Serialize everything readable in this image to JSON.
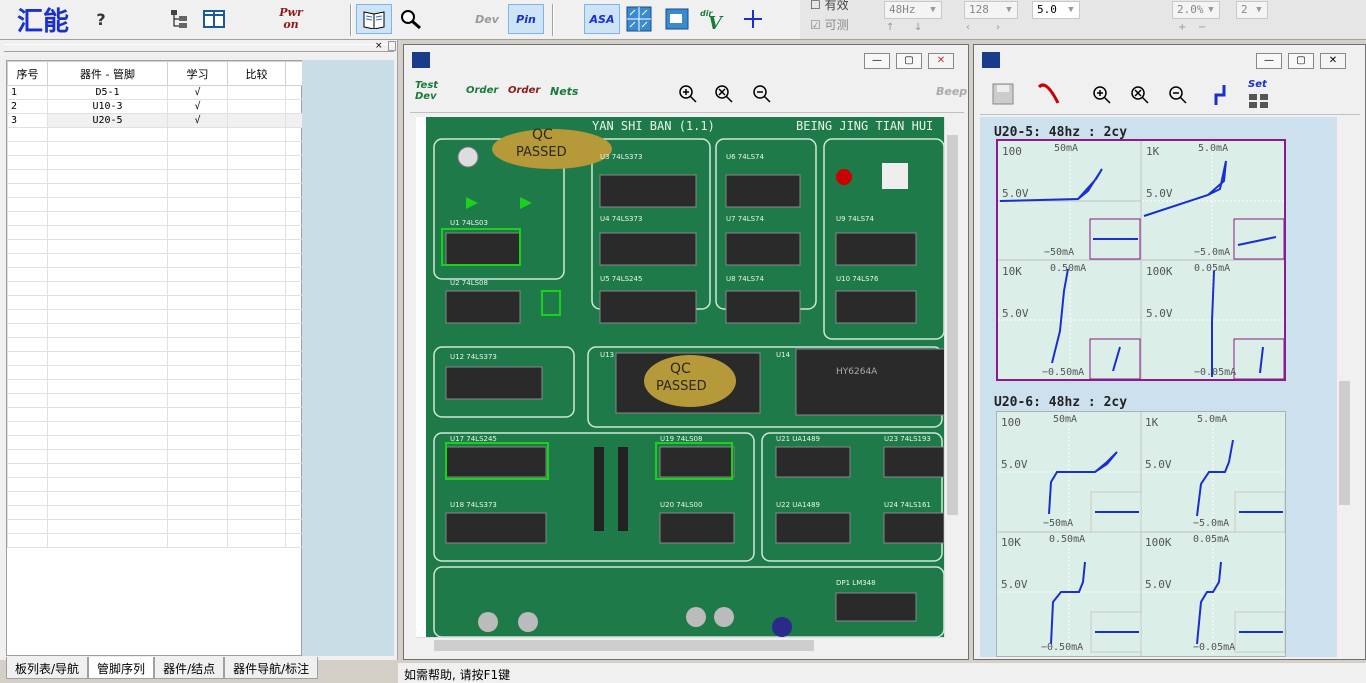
{
  "toolbar": {
    "logo": "汇能",
    "help": "?",
    "pwr_top": "Pwr",
    "pwr_bottom": "on",
    "dev": "Dev",
    "pin": "Pin",
    "asa": "ASA",
    "dirv": "V",
    "dir_small": "dir"
  },
  "params": {
    "row1_label": "有效",
    "row2_label": "可测",
    "freq": "48Hz",
    "points": "128",
    "volt": "5.0",
    "pct": "2.0%",
    "count": "2"
  },
  "left": {
    "columns": [
      "序号",
      "器件 - 管脚",
      "学习",
      "比较"
    ],
    "rows": [
      {
        "n": "1",
        "dev": "D5-1",
        "learn": "√"
      },
      {
        "n": "2",
        "dev": "U10-3",
        "learn": "√"
      },
      {
        "n": "3",
        "dev": "U20-5",
        "learn": "√"
      }
    ],
    "tabs": [
      "板列表/导航",
      "管脚序列",
      "器件/结点",
      "器件导航/标注"
    ]
  },
  "board_win": {
    "tools": [
      "Test Dev",
      "Order",
      "Order",
      "Nets"
    ],
    "beep": "Beep",
    "board_title": "YAN SHI BAN (1.1)",
    "board_title2": "BEING JING TIAN HUI",
    "chips": [
      "U3  74LS373",
      "U6  74LS74",
      "U4  74LS373",
      "U7  74LS74",
      "U9  74LS74",
      "U5  74LS245",
      "U8  74LS74",
      "U10 74LS76",
      "U1  74LS03",
      "U2  74LS08",
      "U12  74LS373",
      "U13",
      "U14",
      "U17  74LS245",
      "U19  74LS08",
      "U21  UA1489",
      "U23  74LS193",
      "U18  74LS373",
      "U20  74LS00",
      "U22  UA1489",
      "U24  74LS161",
      "DP1  LM348"
    ],
    "qc1": "QC",
    "qc2": "PASSED",
    "ram": "HY6264A"
  },
  "wave_win": {
    "set": "Set",
    "groups": [
      {
        "title": "U20-5:  48hz  :  2cy",
        "cells": [
          {
            "r": "100",
            "i": "50mA",
            "v": "5.0V",
            "ni": "−50mA"
          },
          {
            "r": "1K",
            "i": "5.0mA",
            "v": "5.0V",
            "ni": "−5.0mA"
          },
          {
            "r": "10K",
            "i": "0.50mA",
            "v": "5.0V",
            "ni": "−0.50mA"
          },
          {
            "r": "100K",
            "i": "0.05mA",
            "v": "5.0V",
            "ni": "−0.05mA"
          }
        ]
      },
      {
        "title": "U20-6:  48hz  :  2cy",
        "cells": [
          {
            "r": "100",
            "i": "50mA",
            "v": "5.0V",
            "ni": "−50mA"
          },
          {
            "r": "1K",
            "i": "5.0mA",
            "v": "5.0V",
            "ni": "−5.0mA"
          },
          {
            "r": "10K",
            "i": "0.50mA",
            "v": "5.0V",
            "ni": "−0.50mA"
          },
          {
            "r": "100K",
            "i": "0.05mA",
            "v": "5.0V",
            "ni": "−0.05mA"
          }
        ]
      }
    ]
  },
  "status": "如需帮助, 请按F1键",
  "colors": {
    "trace": "#1a2fd0",
    "magenta": "#8b1a8b",
    "board": "#1f7a4a"
  }
}
